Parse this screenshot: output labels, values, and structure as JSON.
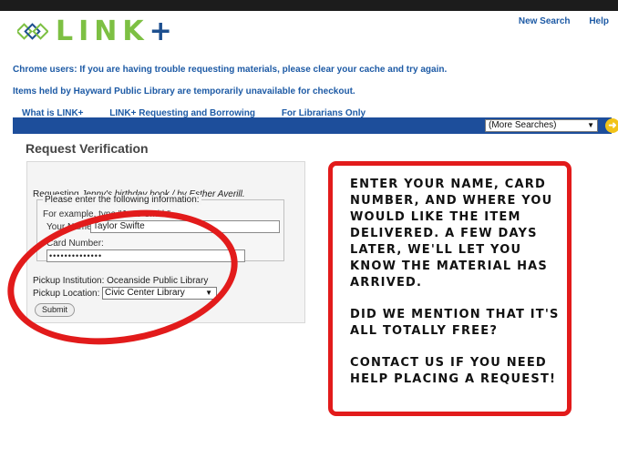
{
  "header": {
    "logo_text": "LINK",
    "logo_plus": "+",
    "links": [
      "New Search",
      "Help"
    ]
  },
  "notices": [
    "Chrome users: If you are having trouble requesting materials, please clear your cache and try again.",
    "Items held by Hayward Public Library are temporarily unavailable for checkout."
  ],
  "nav": {
    "tabs": [
      "What is LINK+",
      "LINK+ Requesting and Borrowing",
      "For Librarians Only"
    ],
    "more_searches": "(More Searches)"
  },
  "form": {
    "title": "Request Verification",
    "requesting_prefix": "Requesting ",
    "requesting_title": "Jenny's birthday book / by Esther Averill.",
    "legend": "Please enter the following information:",
    "example": "For example, type \"Jane Smith\".",
    "name_label": "Your Name:",
    "name_value": "Taylor Swifte",
    "card_label": "Card Number:",
    "card_value": "••••••••••••••",
    "pickup_institution": "Pickup Institution: Oceanside Public Library",
    "pickup_location_label": "Pickup Location:",
    "pickup_location_value": "Civic Center Library",
    "submit_label": "Submit"
  },
  "callout": {
    "paragraphs": [
      "Enter your name, card number, and where you would like the item delivered. A few days later, we'll let you know the material has arrived.",
      "Did we mention that it's all totally free?",
      "Contact us if you need help placing a request!"
    ]
  },
  "colors": {
    "brand_green": "#7dc043",
    "brand_blue": "#1d4f8f",
    "link_blue": "#1d5aa5",
    "nav_bar": "#1d4e9b",
    "annotation_red": "#e21b1b",
    "go_button": "#f2c319"
  }
}
